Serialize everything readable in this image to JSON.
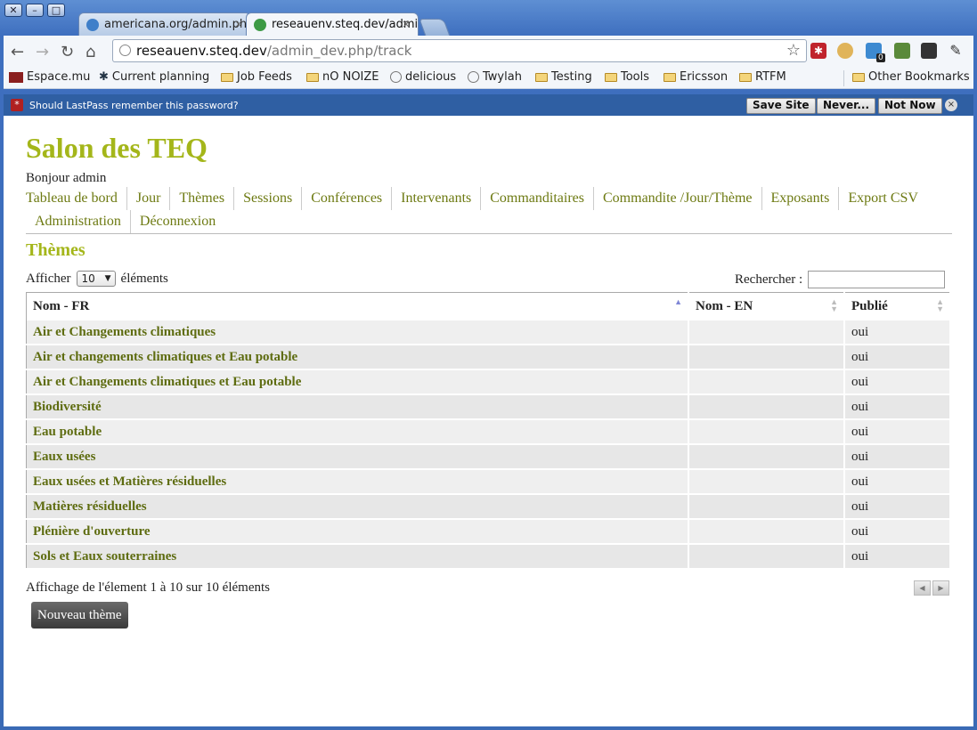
{
  "window_controls": [
    "✕",
    "–",
    "□"
  ],
  "tabs": [
    {
      "title": "americana.org/admin.php/",
      "close": "×",
      "active": false
    },
    {
      "title": "reseauenv.steq.dev/admin",
      "close": "×",
      "active": true
    }
  ],
  "toolbar": {
    "back": "←",
    "forward": "→",
    "reload": "↻",
    "home": "⌂",
    "url_host": "reseauenv.steq.dev",
    "url_path": "/admin_dev.php/track",
    "star": "☆",
    "extensions": [
      "lastpass-icon",
      "cookie-icon",
      "notification-icon",
      "evernote-icon",
      "buffer-icon",
      "wrench-icon"
    ],
    "ext_badge": "0"
  },
  "bookmarks": [
    {
      "label": "Espace.mu",
      "icon": "site-icon"
    },
    {
      "label": "Current planning",
      "icon": "site-icon"
    },
    {
      "label": "Job Feeds",
      "icon": "folder-icon"
    },
    {
      "label": "nO NOIZE",
      "icon": "folder-icon"
    },
    {
      "label": "delicious",
      "icon": "globe-icon"
    },
    {
      "label": "Twylah",
      "icon": "globe-icon"
    },
    {
      "label": "Testing",
      "icon": "folder-icon"
    },
    {
      "label": "Tools",
      "icon": "folder-icon"
    },
    {
      "label": "Ericsson",
      "icon": "folder-icon"
    },
    {
      "label": "RTFM",
      "icon": "folder-icon"
    }
  ],
  "other_bookmarks": "Other Bookmarks",
  "lastpass": {
    "icon": "*",
    "message": "Should LastPass remember this password?",
    "save": "Save Site",
    "never": "Never...",
    "not_now": "Not Now",
    "close": "×"
  },
  "site": {
    "title": "Salon des TEQ",
    "greeting": "Bonjour admin"
  },
  "nav": {
    "row1": [
      "Tableau de bord",
      "Jour",
      "Thèmes",
      "Sessions",
      "Conférences",
      "Intervenants",
      "Commanditaires",
      "Commandite /Jour/Thème",
      "Exposants",
      "Export CSV"
    ],
    "row2": [
      "Administration",
      "Déconnexion"
    ]
  },
  "section_title": "Thèmes",
  "length": {
    "prefix": "Afficher",
    "value": "10",
    "suffix": "éléments",
    "arrow": "▼"
  },
  "search": {
    "label": "Rechercher :"
  },
  "table": {
    "columns": [
      "Nom - FR",
      "Nom - EN",
      "Publié"
    ],
    "rows": [
      [
        "Air et Changements climatiques",
        "",
        "oui"
      ],
      [
        "Air et changements climatiques et Eau potable",
        "",
        "oui"
      ],
      [
        "Air et Changements climatiques et Eau potable",
        "",
        "oui"
      ],
      [
        "Biodiversité",
        "",
        "oui"
      ],
      [
        "Eau potable",
        "",
        "oui"
      ],
      [
        "Eaux usées",
        "",
        "oui"
      ],
      [
        "Eaux usées et Matières résiduelles",
        "",
        "oui"
      ],
      [
        "Matières résiduelles",
        "",
        "oui"
      ],
      [
        "Plénière d'ouverture",
        "",
        "oui"
      ],
      [
        "Sols et Eaux souterraines",
        "",
        "oui"
      ]
    ]
  },
  "info": "Affichage de l'élement 1 à 10 sur 10 éléments",
  "pager": {
    "prev": "◀",
    "next": "▶"
  },
  "new_button": "Nouveau thème"
}
